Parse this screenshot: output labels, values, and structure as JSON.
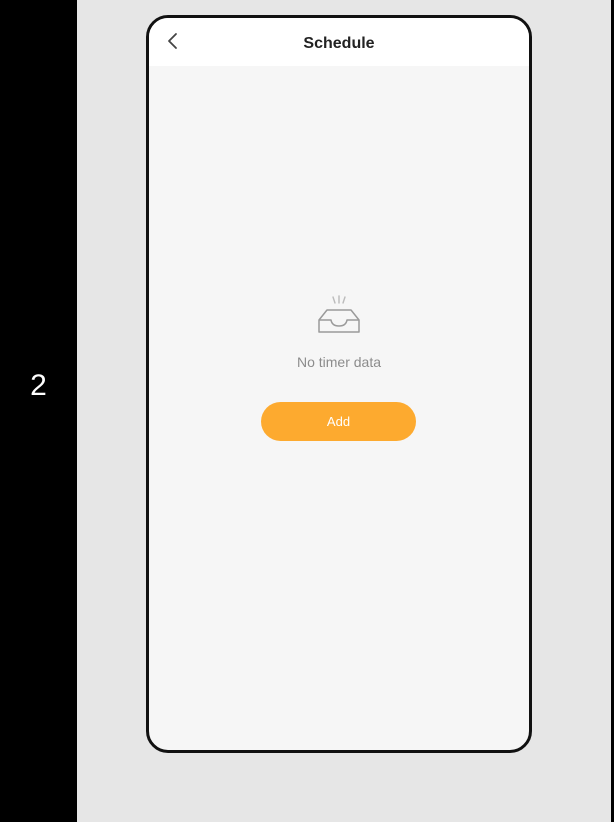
{
  "step": {
    "number": "2"
  },
  "header": {
    "title": "Schedule",
    "back_icon": "chevron-left-icon"
  },
  "empty_state": {
    "icon": "empty-inbox-icon",
    "message": "No timer data"
  },
  "actions": {
    "add_label": "Add"
  },
  "colors": {
    "accent": "#fdaa2f",
    "background": "#f6f6f6",
    "frame": "#111111",
    "page_background": "#e6e6e6",
    "side_strip": "#000000"
  }
}
